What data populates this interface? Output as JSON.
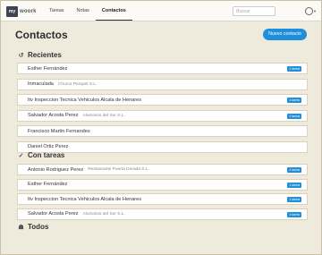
{
  "app": {
    "logo_mark": "my",
    "logo_text": "woork"
  },
  "nav": {
    "items": [
      "Tareas",
      "Notas",
      "Contactos"
    ],
    "active": 2
  },
  "search": {
    "placeholder": "Buscar"
  },
  "page": {
    "title": "Contactos",
    "new_button": "Nuevo contacto"
  },
  "sections": {
    "recientes": {
      "label": "Recientes",
      "icon": "history-icon"
    },
    "con_tareas": {
      "label": "Con tareas",
      "icon": "check-icon"
    },
    "todos": {
      "label": "Todos",
      "icon": "users-icon"
    }
  },
  "recientes": [
    {
      "name": "Esther Fernández",
      "org": "",
      "badge": "1 tarea"
    },
    {
      "name": "Inmaculada",
      "org": "Chumo Parquet S.L.",
      "badge": ""
    },
    {
      "name": "Itv Inspeccion Tecnica Vehiculos Alcala de Henares",
      "org": "",
      "badge": "1 tarea"
    },
    {
      "name": "Salvador Acosta Perez",
      "org": "Aluminios del Sur S.L.",
      "badge": "1 tarea"
    },
    {
      "name": "Francisco Martin Fernandes",
      "org": "",
      "badge": ""
    },
    {
      "name": "Daniel Ortiz Perez",
      "org": "",
      "badge": ""
    }
  ],
  "con_tareas": [
    {
      "name": "Antonio Rodriguez Perez",
      "org": "Restaurante Puerta Dorada S.L.",
      "badge": "1 tarea"
    },
    {
      "name": "Esther Fernández",
      "org": "",
      "badge": "1 tarea"
    },
    {
      "name": "Itv Inspeccion Tecnica Vehiculos Alcala de Henares",
      "org": "",
      "badge": "1 tarea"
    },
    {
      "name": "Salvador Acosta Perez",
      "org": "Aluminios del Sur S.L.",
      "badge": "1 tarea"
    }
  ]
}
